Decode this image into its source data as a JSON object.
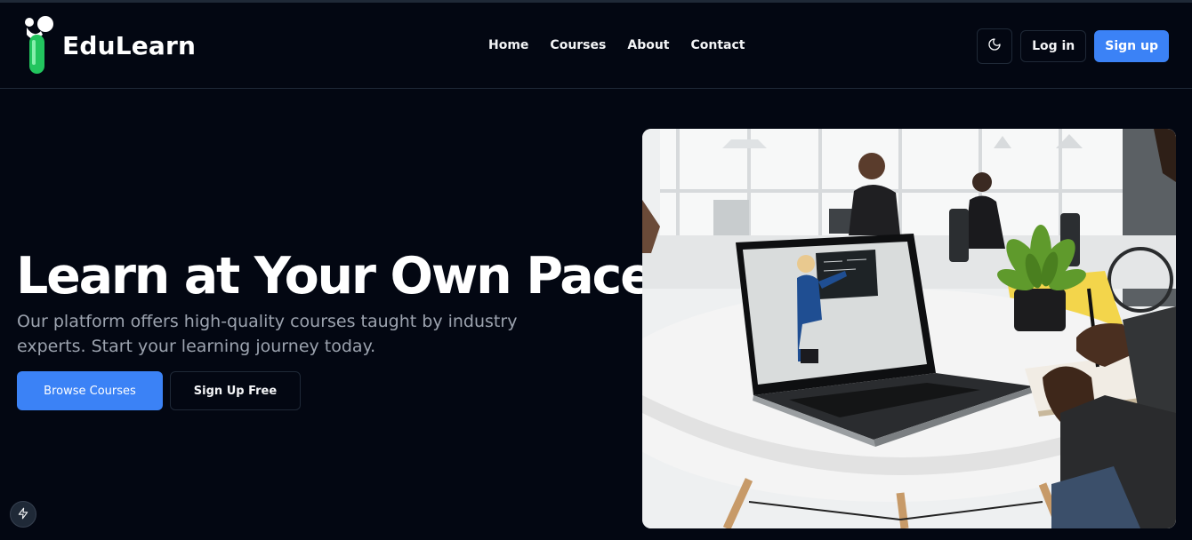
{
  "brand": {
    "name": "EduLearn",
    "logo_icon": "flask-icon",
    "accent_color": "#22c55e"
  },
  "nav": {
    "items": [
      {
        "label": "Home"
      },
      {
        "label": "Courses"
      },
      {
        "label": "About"
      },
      {
        "label": "Contact"
      }
    ]
  },
  "header_actions": {
    "theme_toggle_icon": "moon-icon",
    "login_label": "Log in",
    "signup_label": "Sign up",
    "primary_color": "#3b82f6"
  },
  "hero": {
    "title": "Learn at Your Own Pace",
    "subtitle": "Our platform offers high-quality courses taught by industry experts. Start your learning journey today.",
    "primary_cta": "Browse Courses",
    "secondary_cta": "Sign Up Free",
    "image": "photo-of-laptop-showing-online-class-in-office"
  },
  "devtools_icon": "bolt-icon"
}
